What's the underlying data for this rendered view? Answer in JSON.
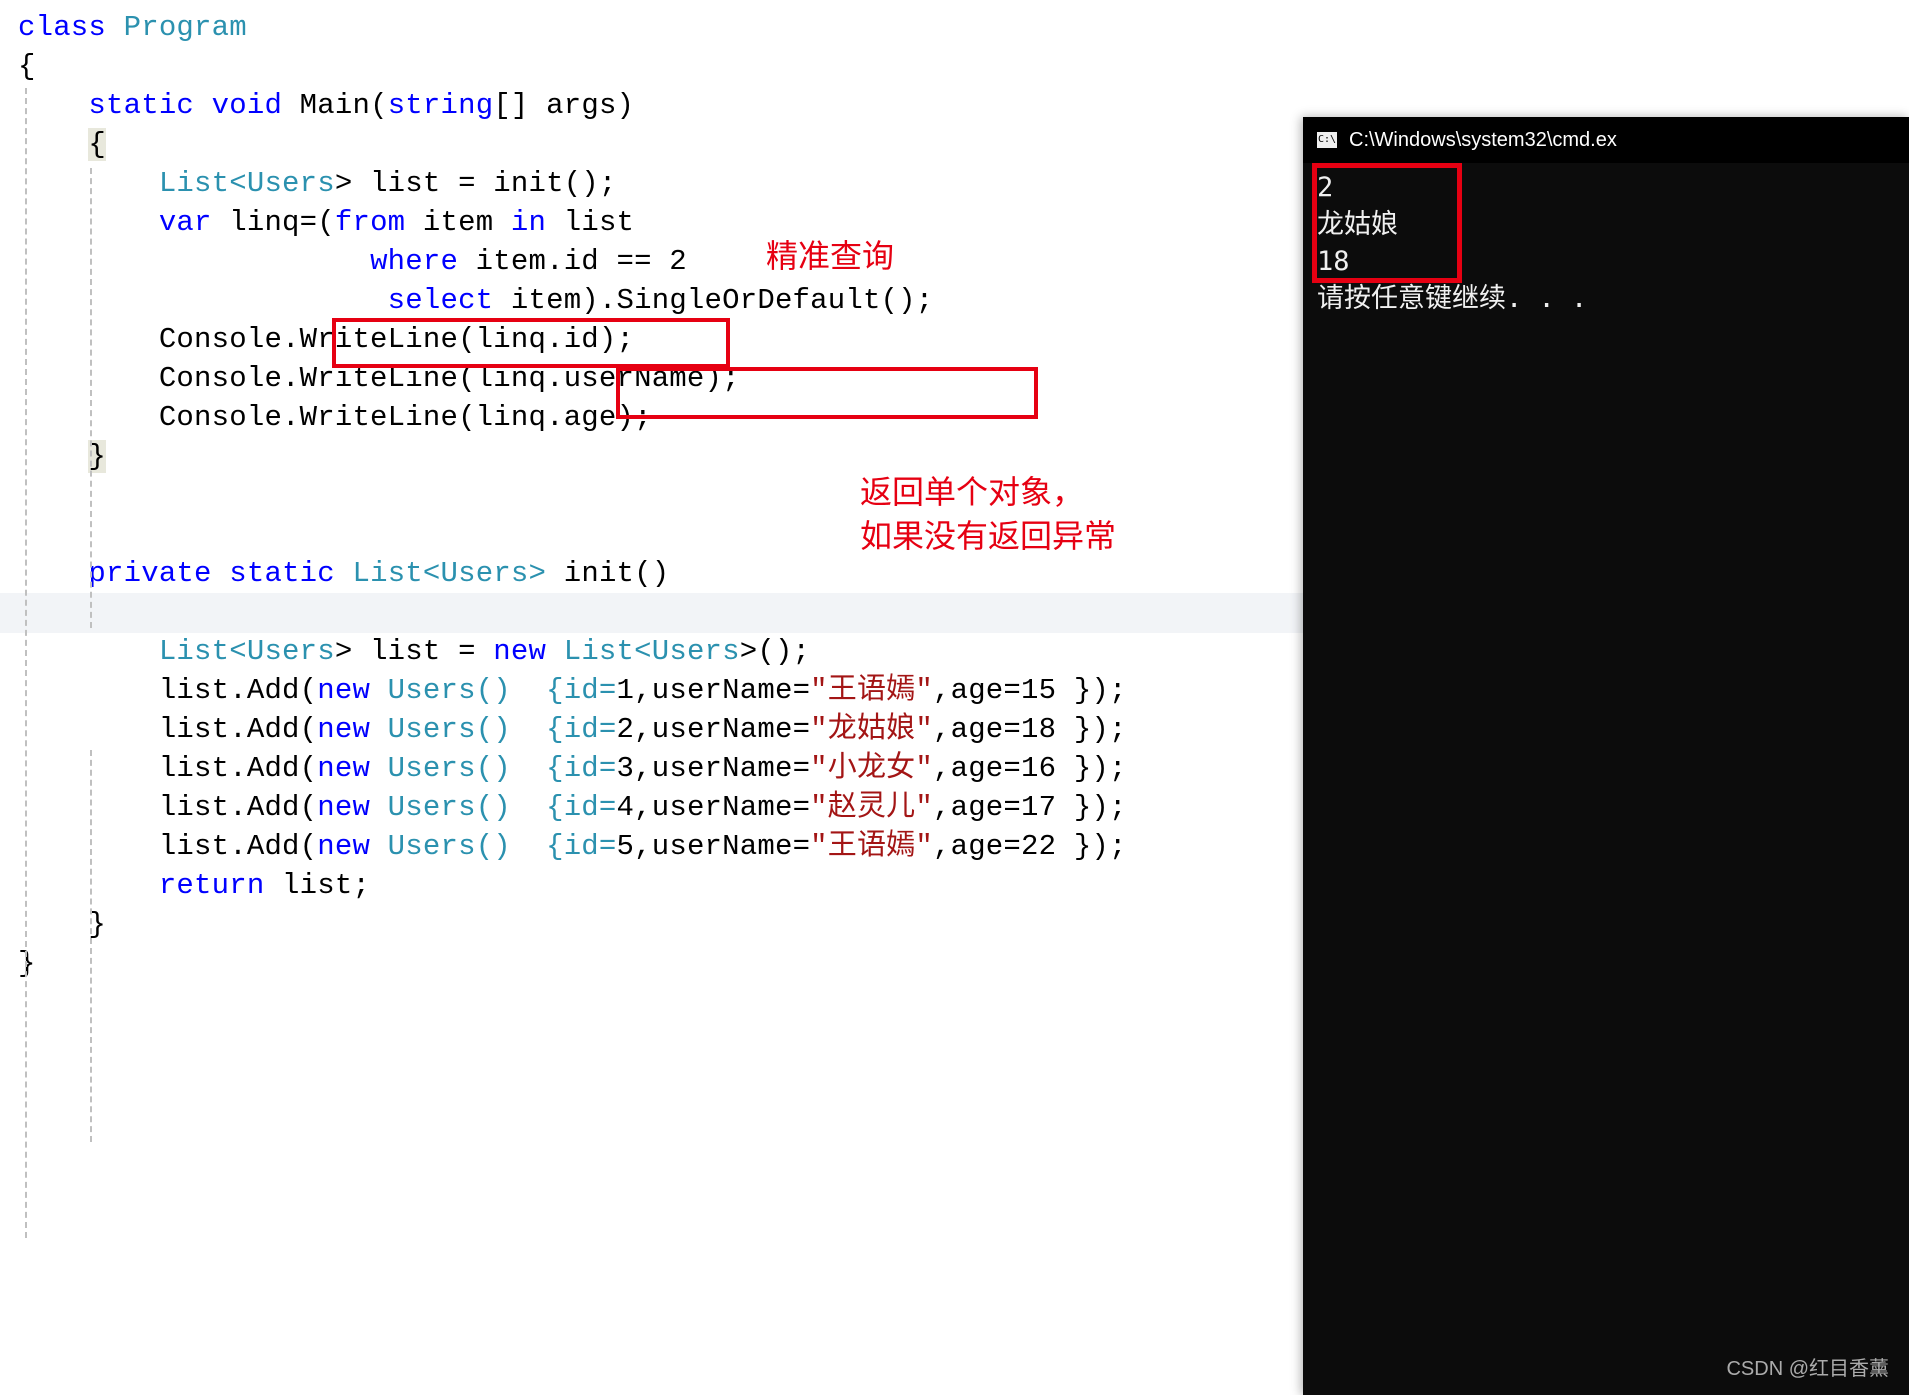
{
  "code": {
    "line1_kw_class": "class",
    "line1_type_program": "Program",
    "brace_open": "{",
    "brace_close": "}",
    "main_sig_pre": "    ",
    "kw_static": "static",
    "kw_void": "void",
    "main_name": " Main(",
    "kw_string": "string",
    "main_tail": "[] args)",
    "indent4": "    ",
    "indent8": "        ",
    "indent12": "            ",
    "indent20": "                    ",
    "indent21": "                     ",
    "list_decl_pre": "List<",
    "type_users": "Users",
    "list_decl_post": "> list = init();",
    "kw_var": "var",
    "var_linq": " linq=(",
    "kw_from": "from",
    "from_mid": " item ",
    "kw_in": "in",
    "from_tail": " list",
    "kw_where": "where",
    "where_tail": " item.id == 2",
    "kw_select": "select",
    "select_tail": " item).SingleOrDefault();",
    "cw1": "Console.WriteLine(linq.id);",
    "cw2": "Console.WriteLine(linq.userName);",
    "cw3": "Console.WriteLine(linq.age);",
    "kw_private": "private",
    "kw_static2": "static",
    "type_listusers_open": "List<",
    "type_listusers_close": ">",
    "init_name": " init()",
    "kw_new": "new",
    "new_list_tail": "List<",
    "new_list_close": ">();",
    "list_eq": " list = ",
    "add_pre": "list.Add(",
    "kw_new2": "new",
    "users_ctor": " Users()  {id=",
    "users1_id": "1",
    "users2_id": "2",
    "users3_id": "3",
    "users4_id": "4",
    "users5_id": "5",
    "users_mid": ",userName=",
    "users1_name": "\"王语嫣\"",
    "users2_name": "\"龙姑娘\"",
    "users3_name": "\"小龙女\"",
    "users4_name": "\"赵灵儿\"",
    "users5_name": "\"王语嫣\"",
    "users_agepre": ",age=",
    "users1_age": "15",
    "users2_age": "18",
    "users3_age": "16",
    "users4_age": "17",
    "users5_age": "22",
    "users_tail": " });",
    "kw_return": "return",
    "return_tail": " list;"
  },
  "annotations": {
    "label_exact_query": "精准查询",
    "label_single_1": "返回单个对象，",
    "label_single_2": "如果没有返回异常"
  },
  "cmd": {
    "title": "C:\\Windows\\system32\\cmd.ex",
    "line1": "2",
    "line2": "龙姑娘",
    "line3": "18",
    "line4": "请按任意键继续. . ."
  },
  "watermark": "CSDN @红目香薰"
}
